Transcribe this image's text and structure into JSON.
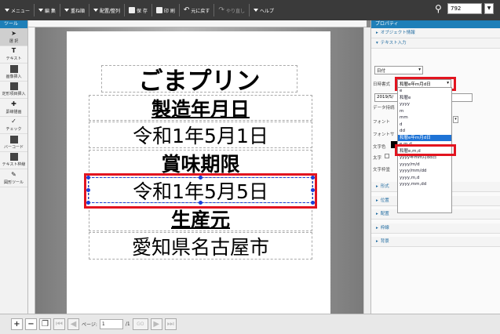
{
  "toolbar": {
    "items": [
      {
        "label": "メニュー",
        "has_dropdown": true
      },
      {
        "label": "編 集",
        "has_dropdown": true
      },
      {
        "label": "重ね順",
        "has_dropdown": true
      },
      {
        "label": "配置/整列",
        "has_dropdown": true
      },
      {
        "label": "保 存"
      },
      {
        "label": "印 刷"
      },
      {
        "label": "元に戻す"
      },
      {
        "label": "やり直し",
        "disabled": true
      },
      {
        "label": "ヘルプ",
        "has_dropdown": true
      }
    ],
    "zoom": "792",
    "zoom_arrow": "▼"
  },
  "tools": {
    "header": "ツール",
    "items": [
      "選 択",
      "テキスト",
      "画像挿入",
      "定形項目挿入",
      "罫線描画",
      "チェック",
      "バーコード",
      "テキスト枠線",
      "図形ツール"
    ]
  },
  "label": {
    "fields": [
      {
        "text": "ごまプリン"
      },
      {
        "text": "製造年月日"
      },
      {
        "text": "令和1年5月1日"
      },
      {
        "text": "賞味期限"
      },
      {
        "text": "令和1年5月5日"
      },
      {
        "text": "生産元"
      },
      {
        "text": "愛知県名古屋市"
      }
    ]
  },
  "bottom": {
    "page_label": "ページ:",
    "page_value": "1",
    "page_total": "/1",
    "go_label": "GO"
  },
  "props": {
    "header": "プロパティ",
    "sections_top": [
      "オブジェクト情報",
      "テキスト入力"
    ],
    "type_value": "日付",
    "format_label": "日時書式",
    "format_value": "和暦e年m月d日",
    "date_value": "2019/5/",
    "rows": [
      "データ持続",
      "フォント",
      "フォントサ",
      "文字色",
      "太字",
      "文字枠塗"
    ],
    "sections_bottom": [
      "形式",
      "位置",
      "配置",
      "枠線",
      "背景"
    ],
    "dropdown_options": [
      "e",
      "和暦e",
      "yyyy",
      "m",
      "mm",
      "d",
      "dd",
      "和暦e年m月d日",
      "e,m,d",
      "和暦e,m,d",
      "yyyy年mm月dd日",
      "yyyy/m/d",
      "yyyy/mm/dd",
      "yyyy,m,d",
      "yyyy,mm,dd"
    ],
    "highlighted_option": "和暦e年m月d日"
  },
  "colors": {
    "accent": "#1e7fb8",
    "highlight_red": "#e2141f",
    "selection_blue": "#1a3fd8",
    "toolbar": "#3a3a3a"
  }
}
